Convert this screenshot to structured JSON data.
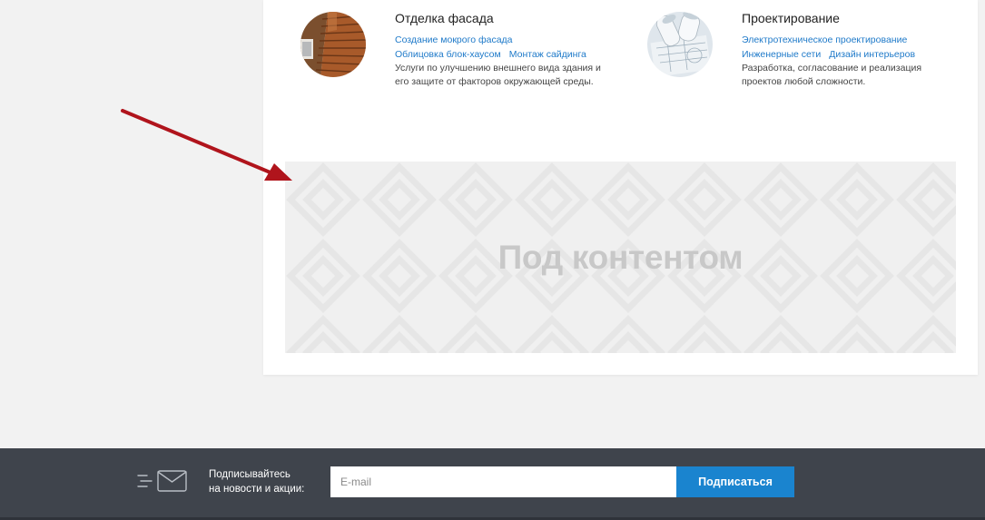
{
  "services": [
    {
      "title": "Отделка фасада",
      "links_row1": [
        "Создание мокрого фасада"
      ],
      "links_row2": [
        "Облицовка блок-хаусом",
        "Монтаж сайдинга"
      ],
      "description": "Услуги по улучшению внешнего вида здания и его защите от факторов окружающей среды.",
      "image": "wood-facade-photo"
    },
    {
      "title": "Проектирование",
      "links_row1": [
        "Электротехническое проектирование"
      ],
      "links_row2": [
        "Инженерные сети",
        "Дизайн интерьеров"
      ],
      "description": "Разработка, согласование и реализация проектов любой сложности.",
      "image": "blueprints-photo"
    }
  ],
  "placeholder": {
    "label": "Под контентом"
  },
  "annotation": {
    "arrow_color": "#b0141c"
  },
  "subscribe": {
    "text": "Подписывайтесь\nна новости и акции:",
    "email_placeholder": "E-mail",
    "button_label": "Подписаться",
    "icon": "envelope-icon",
    "button_color": "#1a84cf",
    "footer_color": "#3f444c"
  }
}
